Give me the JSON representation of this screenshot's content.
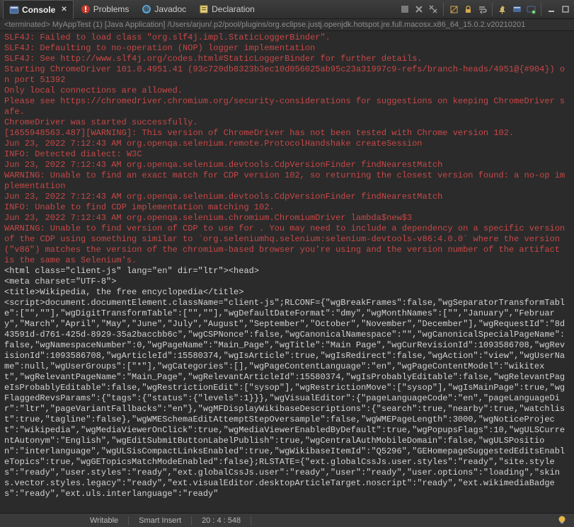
{
  "tabs": {
    "console": "Console",
    "problems": "Problems",
    "javadoc": "Javadoc",
    "declaration": "Declaration"
  },
  "launch": {
    "terminated_prefix": "<terminated>",
    "name": "MyAppTest (1)",
    "type": "[Java Application]",
    "path": "/Users/arjun/.p2/pool/plugins/org.eclipse.justj.openjdk.hotspot.jre.full.macosx.x86_64_15.0.2.v20210201"
  },
  "console_lines": [
    {
      "c": "err",
      "t": "SLF4J: Failed to load class \"org.slf4j.impl.StaticLoggerBinder\"."
    },
    {
      "c": "err",
      "t": "SLF4J: Defaulting to no-operation (NOP) logger implementation"
    },
    {
      "c": "err",
      "t": "SLF4J: See http://www.slf4j.org/codes.html#StaticLoggerBinder for further details."
    },
    {
      "c": "err",
      "t": "Starting ChromeDriver 101.0.4951.41 (93c720db8323b3ec10d056025ab95c23a31997c9-refs/branch-heads/4951@{#904}) on port 51392"
    },
    {
      "c": "err",
      "t": "Only local connections are allowed."
    },
    {
      "c": "err",
      "t": "Please see https://chromedriver.chromium.org/security-considerations for suggestions on keeping ChromeDriver safe."
    },
    {
      "c": "err",
      "t": "ChromeDriver was started successfully."
    },
    {
      "c": "err",
      "t": "[1655948563.487][WARNING]: This version of ChromeDriver has not been tested with Chrome version 102."
    },
    {
      "c": "err",
      "t": "Jun 23, 2022 7:12:43 AM org.openqa.selenium.remote.ProtocolHandshake createSession"
    },
    {
      "c": "err",
      "t": "INFO: Detected dialect: W3C"
    },
    {
      "c": "err",
      "t": "Jun 23, 2022 7:12:43 AM org.openqa.selenium.devtools.CdpVersionFinder findNearestMatch"
    },
    {
      "c": "err",
      "t": "WARNING: Unable to find an exact match for CDP version 102, so returning the closest version found: a no-op implementation"
    },
    {
      "c": "err",
      "t": "Jun 23, 2022 7:12:43 AM org.openqa.selenium.devtools.CdpVersionFinder findNearestMatch"
    },
    {
      "c": "err",
      "t": "INFO: Unable to find CDP implementation matching 102."
    },
    {
      "c": "err",
      "t": "Jun 23, 2022 7:12:43 AM org.openqa.selenium.chromium.ChromiumDriver lambda$new$3"
    },
    {
      "c": "err",
      "t": "WARNING: Unable to find version of CDP to use for . You may need to include a dependency on a specific version of the CDP using something similar to `org.seleniumhq.selenium:selenium-devtools-v86:4.0.0` where the version (\"v86\") matches the version of the chromium-based browser you're using and the version number of the artifact is the same as Selenium's."
    },
    {
      "c": "out",
      "t": "<html class=\"client-js\" lang=\"en\" dir=\"ltr\"><head>"
    },
    {
      "c": "out",
      "t": "<meta charset=\"UTF-8\">"
    },
    {
      "c": "out",
      "t": "<title>Wikipedia, the free encyclopedia</title>"
    },
    {
      "c": "out",
      "t": "<script>document.documentElement.className=\"client-js\";RLCONF={\"wgBreakFrames\":false,\"wgSeparatorTransformTable\":[\"\",\"\"],\"wgDigitTransformTable\":[\"\",\"\"],\"wgDefaultDateFormat\":\"dmy\",\"wgMonthNames\":[\"\",\"January\",\"February\",\"March\",\"April\",\"May\",\"June\",\"July\",\"August\",\"September\",\"October\",\"November\",\"December\"],\"wgRequestId\":\"8d43591d-d761-425d-8929-35a2baccbb6c\",\"wgCSPNonce\":false,\"wgCanonicalNamespace\":\"\",\"wgCanonicalSpecialPageName\":false,\"wgNamespaceNumber\":0,\"wgPageName\":\"Main_Page\",\"wgTitle\":\"Main Page\",\"wgCurRevisionId\":1093586708,\"wgRevisionId\":1093586708,\"wgArticleId\":15580374,\"wgIsArticle\":true,\"wgIsRedirect\":false,\"wgAction\":\"view\",\"wgUserName\":null,\"wgUserGroups\":[\"*\"],\"wgCategories\":[],\"wgPageContentLanguage\":\"en\",\"wgPageContentModel\":\"wikitext\",\"wgRelevantPageName\":\"Main_Page\",\"wgRelevantArticleId\":15580374,\"wgIsProbablyEditable\":false,\"wgRelevantPageIsProbablyEditable\":false,\"wgRestrictionEdit\":[\"sysop\"],\"wgRestrictionMove\":[\"sysop\"],\"wgIsMainPage\":true,\"wgFlaggedRevsParams\":{\"tags\":{\"status\":{\"levels\":1}}},\"wgVisualEditor\":{\"pageLanguageCode\":\"en\",\"pageLanguageDir\":\"ltr\",\"pageVariantFallbacks\":\"en\"},\"wgMFDisplayWikibaseDescriptions\":{\"search\":true,\"nearby\":true,\"watchlist\":true,\"tagline\":false},\"wgWMESchemaEditAttemptStepOversample\":false,\"wgWMEPageLength\":3000,\"wgNoticeProject\":\"wikipedia\",\"wgMediaViewerOnClick\":true,\"wgMediaViewerEnabledByDefault\":true,\"wgPopupsFlags\":10,\"wgULSCurrentAutonym\":\"English\",\"wgEditSubmitButtonLabelPublish\":true,\"wgCentralAuthMobileDomain\":false,\"wgULSPosition\":\"interlanguage\",\"wgULSisCompactLinksEnabled\":true,\"wgWikibaseItemId\":\"Q5296\",\"GEHomepageSuggestedEditsEnableTopics\":true,\"wgGETopicsMatchModeEnabled\":false};RLSTATE={\"ext.globalCssJs.user.styles\":\"ready\",\"site.styles\":\"ready\",\"user.styles\":\"ready\",\"ext.globalCssJs.user\":\"ready\",\"user\":\"ready\",\"user.options\":\"loading\",\"skins.vector.styles.legacy\":\"ready\",\"ext.visualEditor.desktopArticleTarget.noscript\":\"ready\",\"ext.wikimediaBadges\":\"ready\",\"ext.uls.interlanguage\":\"ready\""
    }
  ],
  "status": {
    "writable": "Writable",
    "insert_mode": "Smart Insert",
    "cursor": "20 : 4 : 548"
  }
}
